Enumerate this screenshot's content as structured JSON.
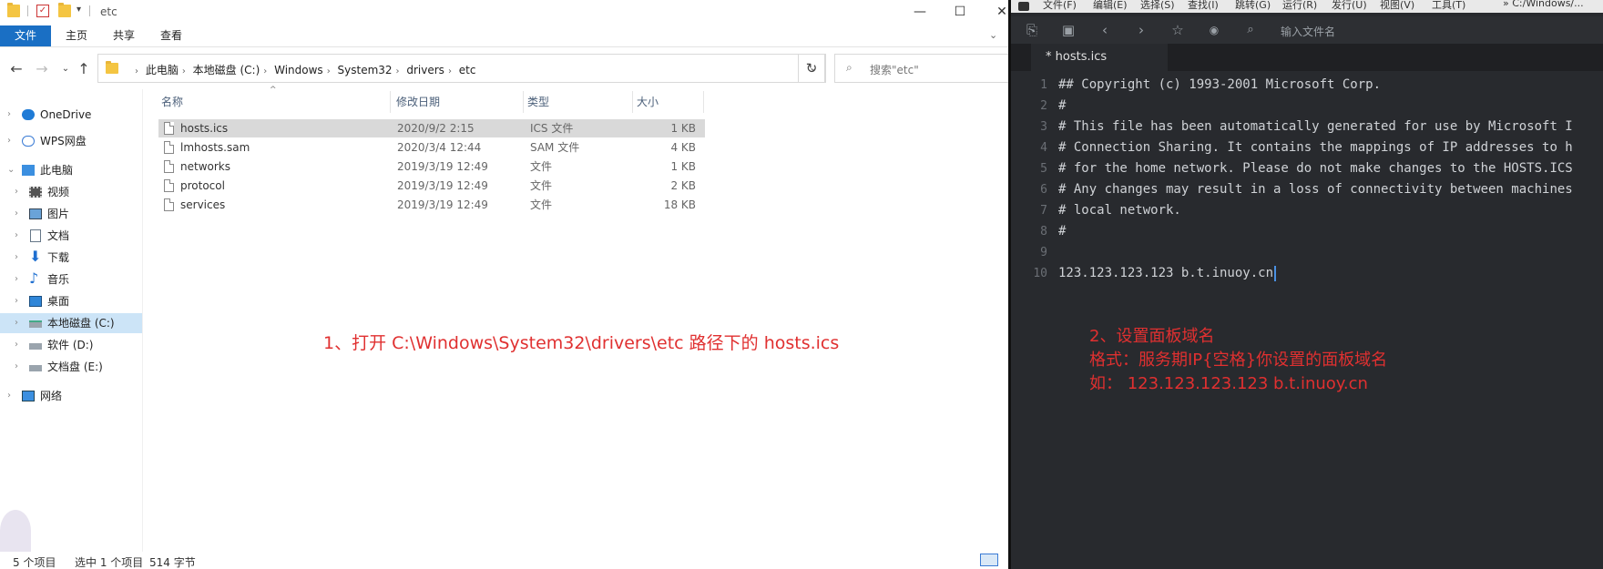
{
  "explorer": {
    "title": "etc",
    "ribbon_tabs": [
      "文件",
      "主页",
      "共享",
      "查看"
    ],
    "breadcrumb": [
      "此电脑",
      "本地磁盘 (C:)",
      "Windows",
      "System32",
      "drivers",
      "etc"
    ],
    "search_placeholder": "搜索\"etc\"",
    "sidebar": [
      {
        "label": "OneDrive",
        "icon": "cloud-icon"
      },
      {
        "label": "WPS网盘",
        "icon": "cloud-outline-icon"
      },
      {
        "label": "此电脑",
        "icon": "computer-icon"
      },
      {
        "label": "视频",
        "icon": "video-icon"
      },
      {
        "label": "图片",
        "icon": "picture-icon"
      },
      {
        "label": "文档",
        "icon": "document-icon"
      },
      {
        "label": "下载",
        "icon": "download-icon"
      },
      {
        "label": "音乐",
        "icon": "music-icon"
      },
      {
        "label": "桌面",
        "icon": "desktop-icon"
      },
      {
        "label": "本地磁盘 (C:)",
        "icon": "drive-c-icon"
      },
      {
        "label": "软件 (D:)",
        "icon": "drive-icon"
      },
      {
        "label": "文档盘 (E:)",
        "icon": "drive-icon"
      },
      {
        "label": "网络",
        "icon": "network-icon"
      }
    ],
    "columns": [
      "名称",
      "修改日期",
      "类型",
      "大小"
    ],
    "files": [
      {
        "name": "hosts.ics",
        "date": "2020/9/2 2:15",
        "type": "ICS 文件",
        "size": "1 KB"
      },
      {
        "name": "lmhosts.sam",
        "date": "2020/3/4 12:44",
        "type": "SAM 文件",
        "size": "4 KB"
      },
      {
        "name": "networks",
        "date": "2019/3/19 12:49",
        "type": "文件",
        "size": "1 KB"
      },
      {
        "name": "protocol",
        "date": "2019/3/19 12:49",
        "type": "文件",
        "size": "2 KB"
      },
      {
        "name": "services",
        "date": "2019/3/19 12:49",
        "type": "文件",
        "size": "18 KB"
      }
    ],
    "status": {
      "count": "5 个项目",
      "selected": "选中 1 个项目",
      "bytes": "514 字节"
    },
    "annotation": "1、打开 C:\\Windows\\System32\\drivers\\etc 路径下的 hosts.ics"
  },
  "editor": {
    "menu": [
      "文件(F)",
      "编辑(E)",
      "选择(S)",
      "查找(I)",
      "跳转(G)",
      "运行(R)",
      "发行(U)",
      "视图(V)",
      "工具(T)",
      "» C:/Windows/..."
    ],
    "input_placeholder": "输入文件名",
    "tab": "* hosts.ics",
    "lines": [
      {
        "n": "1",
        "text": "## Copyright (c) 1993-2001 Microsoft Corp."
      },
      {
        "n": "2",
        "text": "#"
      },
      {
        "n": "3",
        "text": "# This file has been automatically generated for use by Microsoft I"
      },
      {
        "n": "4",
        "text": "# Connection Sharing. It contains the mappings of IP addresses to h"
      },
      {
        "n": "5",
        "text": "# for the home network. Please do not make changes to the HOSTS.ICS"
      },
      {
        "n": "6",
        "text": "# Any changes may result in a loss of connectivity between machines"
      },
      {
        "n": "7",
        "text": "# local network."
      },
      {
        "n": "8",
        "text": "#"
      },
      {
        "n": "9",
        "text": ""
      },
      {
        "n": "10",
        "text": "123.123.123.123 b.t.inuoy.cn"
      }
    ],
    "annotation": {
      "line1": "2、设置面板域名",
      "line2": "格式：服务期IP{空格}你设置的面板域名",
      "line3": "如：  123.123.123.123 b.t.inuoy.cn"
    }
  }
}
